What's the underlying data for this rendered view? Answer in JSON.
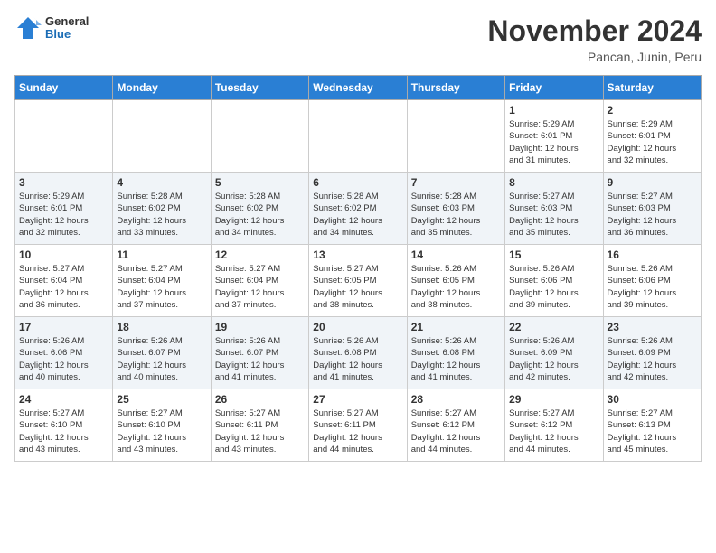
{
  "header": {
    "logo_general": "General",
    "logo_blue": "Blue",
    "month_title": "November 2024",
    "subtitle": "Pancan, Junin, Peru"
  },
  "weekdays": [
    "Sunday",
    "Monday",
    "Tuesday",
    "Wednesday",
    "Thursday",
    "Friday",
    "Saturday"
  ],
  "weeks": [
    [
      {
        "day": "",
        "info": ""
      },
      {
        "day": "",
        "info": ""
      },
      {
        "day": "",
        "info": ""
      },
      {
        "day": "",
        "info": ""
      },
      {
        "day": "",
        "info": ""
      },
      {
        "day": "1",
        "info": "Sunrise: 5:29 AM\nSunset: 6:01 PM\nDaylight: 12 hours\nand 31 minutes."
      },
      {
        "day": "2",
        "info": "Sunrise: 5:29 AM\nSunset: 6:01 PM\nDaylight: 12 hours\nand 32 minutes."
      }
    ],
    [
      {
        "day": "3",
        "info": "Sunrise: 5:29 AM\nSunset: 6:01 PM\nDaylight: 12 hours\nand 32 minutes."
      },
      {
        "day": "4",
        "info": "Sunrise: 5:28 AM\nSunset: 6:02 PM\nDaylight: 12 hours\nand 33 minutes."
      },
      {
        "day": "5",
        "info": "Sunrise: 5:28 AM\nSunset: 6:02 PM\nDaylight: 12 hours\nand 34 minutes."
      },
      {
        "day": "6",
        "info": "Sunrise: 5:28 AM\nSunset: 6:02 PM\nDaylight: 12 hours\nand 34 minutes."
      },
      {
        "day": "7",
        "info": "Sunrise: 5:28 AM\nSunset: 6:03 PM\nDaylight: 12 hours\nand 35 minutes."
      },
      {
        "day": "8",
        "info": "Sunrise: 5:27 AM\nSunset: 6:03 PM\nDaylight: 12 hours\nand 35 minutes."
      },
      {
        "day": "9",
        "info": "Sunrise: 5:27 AM\nSunset: 6:03 PM\nDaylight: 12 hours\nand 36 minutes."
      }
    ],
    [
      {
        "day": "10",
        "info": "Sunrise: 5:27 AM\nSunset: 6:04 PM\nDaylight: 12 hours\nand 36 minutes."
      },
      {
        "day": "11",
        "info": "Sunrise: 5:27 AM\nSunset: 6:04 PM\nDaylight: 12 hours\nand 37 minutes."
      },
      {
        "day": "12",
        "info": "Sunrise: 5:27 AM\nSunset: 6:04 PM\nDaylight: 12 hours\nand 37 minutes."
      },
      {
        "day": "13",
        "info": "Sunrise: 5:27 AM\nSunset: 6:05 PM\nDaylight: 12 hours\nand 38 minutes."
      },
      {
        "day": "14",
        "info": "Sunrise: 5:26 AM\nSunset: 6:05 PM\nDaylight: 12 hours\nand 38 minutes."
      },
      {
        "day": "15",
        "info": "Sunrise: 5:26 AM\nSunset: 6:06 PM\nDaylight: 12 hours\nand 39 minutes."
      },
      {
        "day": "16",
        "info": "Sunrise: 5:26 AM\nSunset: 6:06 PM\nDaylight: 12 hours\nand 39 minutes."
      }
    ],
    [
      {
        "day": "17",
        "info": "Sunrise: 5:26 AM\nSunset: 6:06 PM\nDaylight: 12 hours\nand 40 minutes."
      },
      {
        "day": "18",
        "info": "Sunrise: 5:26 AM\nSunset: 6:07 PM\nDaylight: 12 hours\nand 40 minutes."
      },
      {
        "day": "19",
        "info": "Sunrise: 5:26 AM\nSunset: 6:07 PM\nDaylight: 12 hours\nand 41 minutes."
      },
      {
        "day": "20",
        "info": "Sunrise: 5:26 AM\nSunset: 6:08 PM\nDaylight: 12 hours\nand 41 minutes."
      },
      {
        "day": "21",
        "info": "Sunrise: 5:26 AM\nSunset: 6:08 PM\nDaylight: 12 hours\nand 41 minutes."
      },
      {
        "day": "22",
        "info": "Sunrise: 5:26 AM\nSunset: 6:09 PM\nDaylight: 12 hours\nand 42 minutes."
      },
      {
        "day": "23",
        "info": "Sunrise: 5:26 AM\nSunset: 6:09 PM\nDaylight: 12 hours\nand 42 minutes."
      }
    ],
    [
      {
        "day": "24",
        "info": "Sunrise: 5:27 AM\nSunset: 6:10 PM\nDaylight: 12 hours\nand 43 minutes."
      },
      {
        "day": "25",
        "info": "Sunrise: 5:27 AM\nSunset: 6:10 PM\nDaylight: 12 hours\nand 43 minutes."
      },
      {
        "day": "26",
        "info": "Sunrise: 5:27 AM\nSunset: 6:11 PM\nDaylight: 12 hours\nand 43 minutes."
      },
      {
        "day": "27",
        "info": "Sunrise: 5:27 AM\nSunset: 6:11 PM\nDaylight: 12 hours\nand 44 minutes."
      },
      {
        "day": "28",
        "info": "Sunrise: 5:27 AM\nSunset: 6:12 PM\nDaylight: 12 hours\nand 44 minutes."
      },
      {
        "day": "29",
        "info": "Sunrise: 5:27 AM\nSunset: 6:12 PM\nDaylight: 12 hours\nand 44 minutes."
      },
      {
        "day": "30",
        "info": "Sunrise: 5:27 AM\nSunset: 6:13 PM\nDaylight: 12 hours\nand 45 minutes."
      }
    ]
  ]
}
